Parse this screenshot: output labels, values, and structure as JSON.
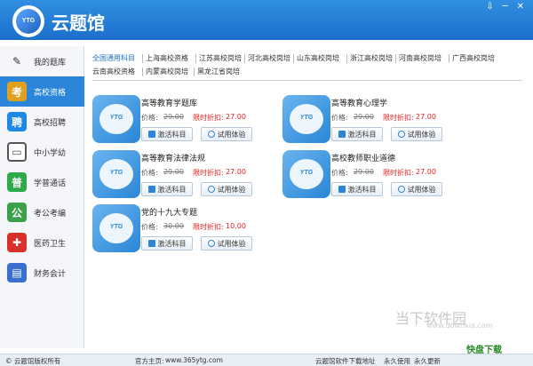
{
  "app": {
    "title": "云题馆",
    "logo_text": "YTG"
  },
  "window": {
    "controls": [
      "⇩",
      "─",
      "✕"
    ]
  },
  "sidebar": {
    "items": [
      {
        "label": "我的题库",
        "icon": "pencil-icon",
        "glyph": "✎",
        "color": "#ffffff",
        "active": false
      },
      {
        "label": "高校资格",
        "icon": "kao-icon",
        "glyph": "考",
        "color": "#e0a020",
        "active": true
      },
      {
        "label": "高校招聘",
        "icon": "pin-icon",
        "glyph": "聘",
        "color": "#1e88e5",
        "active": false
      },
      {
        "label": "中小学幼",
        "icon": "book-icon",
        "glyph": "▭",
        "color": "#555555",
        "active": false
      },
      {
        "label": "学普通话",
        "icon": "pu-icon",
        "glyph": "普",
        "color": "#2eaa4a",
        "active": false
      },
      {
        "label": "考公考编",
        "icon": "civil-icon",
        "glyph": "公",
        "color": "#3aa04a",
        "active": false
      },
      {
        "label": "医药卫生",
        "icon": "medical-icon",
        "glyph": "✚",
        "color": "#d8302a",
        "active": false
      },
      {
        "label": "财务会计",
        "icon": "chart-icon",
        "glyph": "▤",
        "color": "#3a6fd0",
        "active": false
      }
    ]
  },
  "tabs": [
    {
      "label": "全国通用科目",
      "active": true
    },
    {
      "label": "上海高校资格"
    },
    {
      "label": "江苏高校岗培"
    },
    {
      "label": "河北高校岗培"
    },
    {
      "label": "山东高校岗培"
    },
    {
      "label": "浙江高校岗培"
    },
    {
      "label": "河南高校岗培"
    },
    {
      "label": "广西高校岗培"
    },
    {
      "label": "云南高校资格"
    },
    {
      "label": "内蒙高校岗培"
    },
    {
      "label": "黑龙江省岗培"
    }
  ],
  "cards": [
    {
      "title": "高等教育学题库",
      "price_label": "价格:",
      "old_price": "29.00",
      "disc_label": "限时折扣:",
      "disc_price": "27.00",
      "activate": "激活科目",
      "trial": "试用体验"
    },
    {
      "title": "高等教育心理学",
      "price_label": "价格:",
      "old_price": "29.00",
      "disc_label": "限时折扣:",
      "disc_price": "27.00",
      "activate": "激活科目",
      "trial": "试用体验"
    },
    {
      "title": "高等教育法律法规",
      "price_label": "价格:",
      "old_price": "29.00",
      "disc_label": "限时折扣:",
      "disc_price": "27.00",
      "activate": "激活科目",
      "trial": "试用体验"
    },
    {
      "title": "高校教师职业道德",
      "price_label": "价格:",
      "old_price": "29.00",
      "disc_label": "限时折扣:",
      "disc_price": "27.00",
      "activate": "激活科目",
      "trial": "试用体验"
    },
    {
      "title": "党的十九大专题",
      "price_label": "价格:",
      "old_price": "30.00",
      "disc_label": "限时折扣:",
      "disc_price": "10.00",
      "activate": "激活科目",
      "trial": "试用体验"
    }
  ],
  "status": {
    "copyright": "© 云题馆版权所有",
    "homepage_label": "官方主页:",
    "homepage_url": "www.365ytg.com",
    "download": "云题馆软件下载地址",
    "forever": "永久使用",
    "update": "永久更新"
  },
  "watermark": {
    "text": "当下软件园",
    "url": "www.downxia.com",
    "badge": "快盘下载"
  }
}
